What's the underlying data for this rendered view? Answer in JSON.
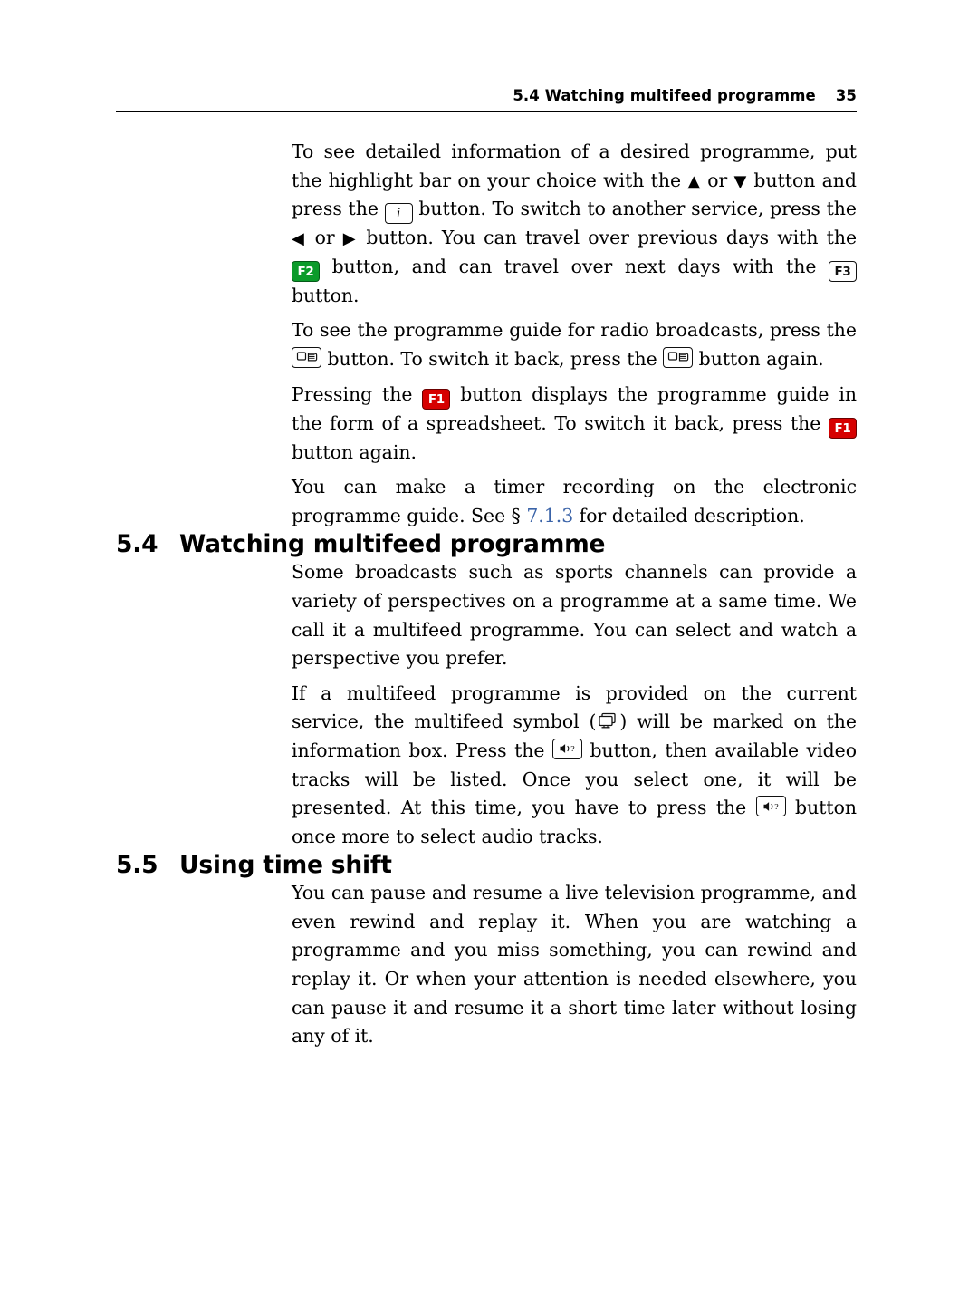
{
  "header": {
    "title": "5.4 Watching multifeed programme",
    "page_number": "35"
  },
  "body": {
    "p1": {
      "t1": "To see detailed information of a desired programme, put the highlight bar on your choice with the ",
      "t2": " or ",
      "t3": " button and press the ",
      "t4": " button. To switch to another service, press the ",
      "t5": " or ",
      "t6": " button. You can travel over previous days with the ",
      "t7": " button, and can travel over next days with the ",
      "t8": " button.",
      "key_i": "i",
      "key_f2": "F2",
      "key_f3": "F3",
      "arrow_up": "▲",
      "arrow_down": "▼",
      "arrow_left": "◀",
      "arrow_right": "▶"
    },
    "p2": {
      "t1": "To see the programme guide for radio broadcasts, press the ",
      "t2": " button. To switch it back, press the ",
      "t3": " button again.",
      "icon": "tv-radio-toggle-icon"
    },
    "p3": {
      "t1": "Pressing the ",
      "t2": " button displays the programme guide in the form of a spreadsheet. To switch it back, press the ",
      "t3": " button again.",
      "key_f1": "F1"
    },
    "p4": {
      "t1": "You can make a timer recording on the electronic programme guide. See § ",
      "xref": "7.1.3",
      "t2": " for detailed description."
    },
    "section_54": {
      "number": "5.4",
      "title": "Watching multifeed programme"
    },
    "p5": "Some broadcasts such as sports channels can provide a variety of perspectives on a programme at a same time. We call it a multifeed programme. You can select and watch a perspective you prefer.",
    "p6": {
      "t1": "If a multifeed programme is provided on the current service, the multifeed symbol (",
      "t2": ") will be marked on the information box. Press the ",
      "t3": " button, then available video tracks will be listed. Once you select one, it will be presented. At this time, you have to press the ",
      "t4": " button once more to select audio tracks.",
      "icon_multifeed": "multifeed-icon",
      "icon_audio": "audio-track-icon"
    },
    "section_55": {
      "number": "5.5",
      "title": "Using time shift"
    },
    "p7": "You can pause and resume a live television programme, and even rewind and replay it. When you are watching a programme and you miss something, you can rewind and replay it. Or when your attention is needed elsewhere, you can pause it and resume it a short time later without losing any of it."
  },
  "colors": {
    "xref": "#3a63a8",
    "f1_red": "#d60000",
    "f2_green": "#0b9b2a",
    "text": "#000000"
  }
}
